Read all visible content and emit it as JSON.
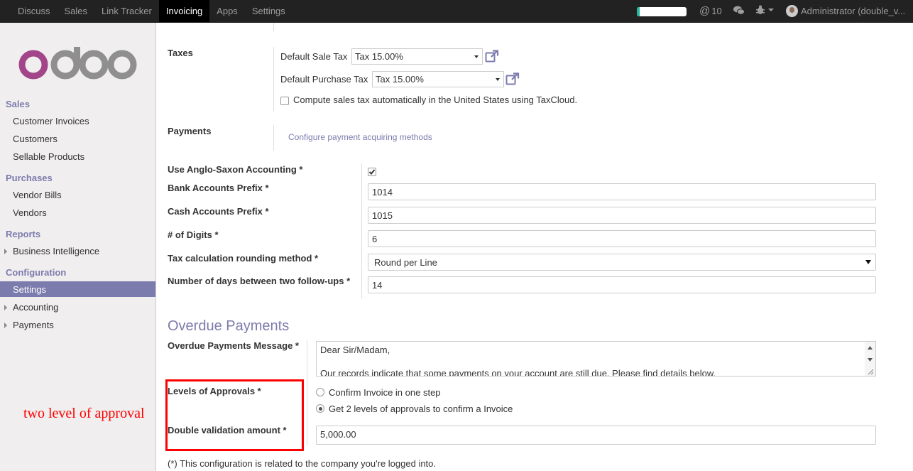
{
  "topbar": {
    "menu": [
      "Discuss",
      "Sales",
      "Link Tracker",
      "Invoicing",
      "Apps",
      "Settings"
    ],
    "active_index": 3,
    "progress_fraction": 0.05,
    "messages_count": "10",
    "user_name": "Administrator (double_v...",
    "icons": [
      "at-icon",
      "chat-icon",
      "bug-icon",
      "caret-down-icon",
      "avatar"
    ],
    "colors": {
      "bar_bg": "#222222",
      "active_bg": "#000000",
      "progress": "#21b799"
    }
  },
  "sidebar": {
    "logo_text": "odoo",
    "sections": [
      {
        "title": "Sales",
        "items": [
          "Customer Invoices",
          "Customers",
          "Sellable Products"
        ]
      },
      {
        "title": "Purchases",
        "items": [
          "Vendor Bills",
          "Vendors"
        ]
      },
      {
        "title": "Reports",
        "items": [
          "Business Intelligence"
        ]
      },
      {
        "title": "Configuration",
        "items": [
          "Settings",
          "Accounting",
          "Payments"
        ]
      }
    ],
    "active_item": "Settings",
    "accent": "#7c7bad"
  },
  "taxes": {
    "label": "Taxes",
    "default_sale_tax_label": "Default Sale Tax",
    "default_sale_tax_value": "Tax 15.00%",
    "default_purchase_tax_label": "Default Purchase Tax",
    "default_purchase_tax_value": "Tax 15.00%",
    "taxcloud_label": "Compute sales tax automatically in the United States using TaxCloud.",
    "taxcloud_checked": false
  },
  "payments": {
    "label": "Payments",
    "link": "Configure payment acquiring methods"
  },
  "fields": {
    "anglo_saxon_label": "Use Anglo-Saxon Accounting *",
    "anglo_saxon_checked": true,
    "bank_prefix_label": "Bank Accounts Prefix *",
    "bank_prefix_value": "1014",
    "cash_prefix_label": "Cash Accounts Prefix *",
    "cash_prefix_value": "1015",
    "digits_label": "# of Digits *",
    "digits_value": "6",
    "rounding_label": "Tax calculation rounding method *",
    "rounding_value": "Round per Line",
    "followup_label": "Number of days between two follow-ups *",
    "followup_value": "14"
  },
  "overdue": {
    "heading": "Overdue Payments",
    "message_label": "Overdue Payments Message *",
    "message_line1": "Dear Sir/Madam,",
    "message_line3": "Our records indicate that some payments on your account are still due. Please find details below.",
    "approvals_label": "Levels of Approvals *",
    "approval_option_1": "Confirm Invoice in one step",
    "approval_option_2": "Get 2 levels of approvals to confirm a Invoice",
    "approval_selected": 2,
    "double_validation_label": "Double validation amount *",
    "double_validation_value": "5,000.00"
  },
  "footer_note": "(*) This configuration is related to the company you're logged into.",
  "annotation": {
    "text": "two level of approval",
    "color": "#ff0000"
  }
}
